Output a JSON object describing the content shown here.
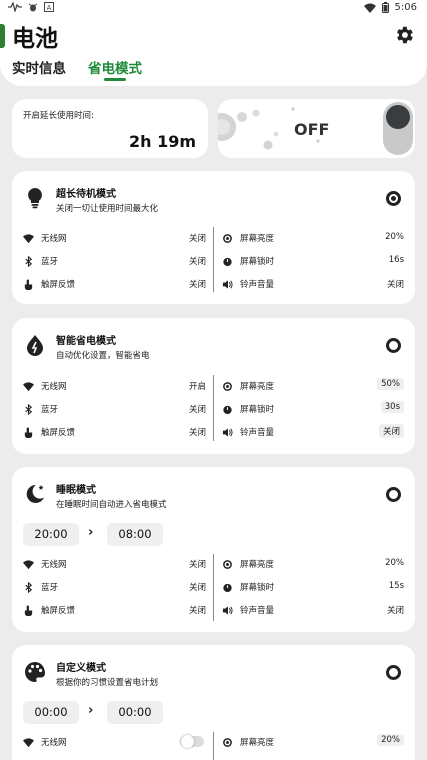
{
  "status_bar": {
    "time": "5:06",
    "left_icons": [
      "signal-wave-icon",
      "bug-icon",
      "a-icon"
    ],
    "right_icons": [
      "wifi-icon",
      "battery-icon"
    ]
  },
  "header": {
    "title": "电池",
    "tabs": [
      {
        "label": "实时信息",
        "active": false
      },
      {
        "label": "省电模式",
        "active": true
      }
    ]
  },
  "extend_card": {
    "label": "开启延长使用时间:",
    "value": "2h 19m"
  },
  "off_card": {
    "label": "OFF",
    "toggle_on": false
  },
  "modes": [
    {
      "title": "超长待机模式",
      "desc": "关闭一切让使用时间最大化",
      "selected": true,
      "settings_left": [
        {
          "label": "无线网",
          "value": "关闭"
        },
        {
          "label": "蓝牙",
          "value": "关闭"
        },
        {
          "label": "触屏反馈",
          "value": "关闭"
        }
      ],
      "settings_right": [
        {
          "label": "屏幕亮度",
          "value": "20%"
        },
        {
          "label": "屏幕锁时",
          "value": "16s"
        },
        {
          "label": "铃声音量",
          "value": "关闭"
        }
      ]
    },
    {
      "title": "智能省电模式",
      "desc": "自动优化设置，智能省电",
      "selected": false,
      "settings_left": [
        {
          "label": "无线网",
          "value": "开启"
        },
        {
          "label": "蓝牙",
          "value": "关闭"
        },
        {
          "label": "触屏反馈",
          "value": "关闭"
        }
      ],
      "settings_right": [
        {
          "label": "屏幕亮度",
          "value": "50%"
        },
        {
          "label": "屏幕锁时",
          "value": "30s"
        },
        {
          "label": "铃声音量",
          "value": "关闭"
        }
      ]
    },
    {
      "title": "睡眠模式",
      "desc": "在睡眠时间自动进入省电模式",
      "selected": false,
      "start_time": "20:00",
      "end_time": "08:00",
      "settings_left": [
        {
          "label": "无线网",
          "value": "关闭"
        },
        {
          "label": "蓝牙",
          "value": "关闭"
        },
        {
          "label": "触屏反馈",
          "value": "关闭"
        }
      ],
      "settings_right": [
        {
          "label": "屏幕亮度",
          "value": "20%"
        },
        {
          "label": "屏幕锁时",
          "value": "15s"
        },
        {
          "label": "铃声音量",
          "value": "关闭"
        }
      ]
    },
    {
      "title": "自定义模式",
      "desc": "根据你的习惯设置省电计划",
      "selected": false,
      "start_time": "00:00",
      "end_time": "00:00",
      "settings_left": [
        {
          "label": "无线网",
          "switch_on": false
        }
      ],
      "settings_right": [
        {
          "label": "屏幕亮度",
          "value": "20%"
        }
      ]
    }
  ],
  "colors": {
    "accent": "#1f8a3a",
    "background": "#ececec",
    "card": "#ffffff"
  }
}
